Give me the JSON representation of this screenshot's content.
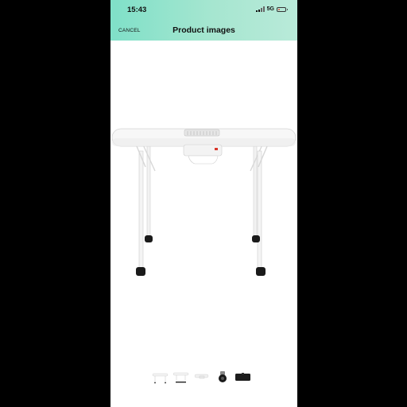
{
  "status_bar": {
    "time": "15:43",
    "network": "5G",
    "battery_level": 0.2,
    "battery_color": "#e2483b"
  },
  "header": {
    "cancel_label": "CANCEL",
    "title": "Product images",
    "gradient_colors": [
      "#7fe0c8",
      "#b9ead9"
    ]
  },
  "main_image": {
    "subject": "white portable manicure table with dust collector fan and casters"
  },
  "thumbnails": {
    "count": 5,
    "selected_index": 0
  }
}
